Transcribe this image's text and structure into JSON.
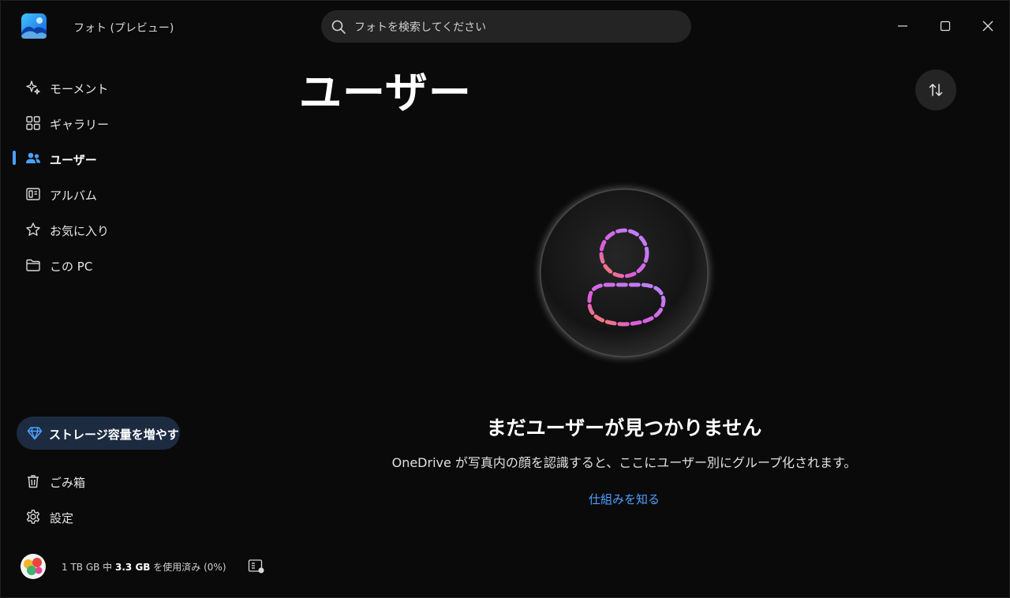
{
  "app": {
    "title": "フォト (プレビュー)"
  },
  "search": {
    "placeholder": "フォトを検索してください"
  },
  "sidebar": {
    "items": [
      {
        "label": "モーメント",
        "icon": "sparkle-icon"
      },
      {
        "label": "ギャラリー",
        "icon": "grid-icon"
      },
      {
        "label": "ユーザー",
        "icon": "people-icon",
        "active": true
      },
      {
        "label": "アルバム",
        "icon": "album-icon"
      },
      {
        "label": "お気に入り",
        "icon": "star-icon"
      },
      {
        "label": "この PC",
        "icon": "folder-icon"
      }
    ],
    "storage_button": "ストレージ容量を増やす",
    "bottom_items": [
      {
        "label": "ごみ箱",
        "icon": "trash-icon"
      },
      {
        "label": "設定",
        "icon": "gear-icon"
      }
    ],
    "footer": {
      "total": "1 TB GB 中",
      "used": "3.3 GB",
      "suffix": "を使用済み (0%)"
    }
  },
  "main": {
    "title": "ユーザー",
    "empty_title": "まだユーザーが見つかりません",
    "empty_description": "OneDrive が写真内の顔を認識すると、ここにユーザー別にグループ化されます。",
    "learn_link": "仕組みを知る"
  },
  "colors": {
    "accent": "#4ca0ff",
    "background": "#0a0a0a",
    "storage_button_bg": "#1c2b40"
  }
}
